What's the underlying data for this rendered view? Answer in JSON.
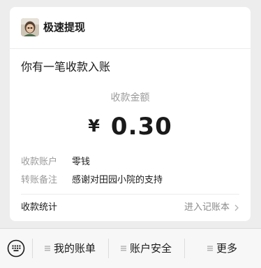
{
  "card": {
    "app_name": "极速提现",
    "notice_title": "你有一笔收款入账",
    "amount_label": "收款金额",
    "currency_symbol": "¥",
    "amount_value": "0.30",
    "rows": [
      {
        "key": "收款账户",
        "value": "零钱"
      },
      {
        "key": "转账备注",
        "value": "感谢对田园小院的支持"
      }
    ],
    "stats_label": "收款统计",
    "stats_link": "进入记账本"
  },
  "bottom_menu": {
    "items": [
      {
        "label": "我的账单"
      },
      {
        "label": "账户安全"
      },
      {
        "label": "更多"
      }
    ]
  },
  "icons": {
    "avatar": "avatar-image",
    "chevron": "chevron-right-icon",
    "keyboard": "keyboard-icon",
    "menu": "menu-lines-icon"
  }
}
